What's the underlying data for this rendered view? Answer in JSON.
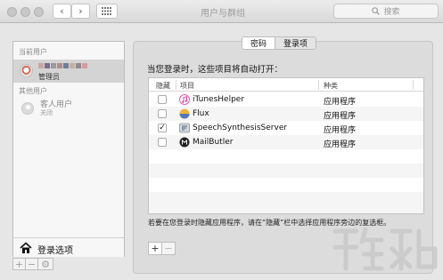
{
  "window": {
    "title": "用户与群组",
    "search_placeholder": "搜索",
    "back_icon": "‹",
    "forward_icon": "›"
  },
  "sidebar": {
    "current_users_label": "当前用户",
    "current_user_role": "管理员",
    "other_users_label": "其他用户",
    "guest_name": "客人用户",
    "guest_status": "关闭",
    "login_options_label": "登录选项",
    "add_label": "+",
    "remove_label": "−",
    "gear_label": "⚙"
  },
  "tabs": [
    {
      "label": "密码",
      "active": false
    },
    {
      "label": "登录项",
      "active": true
    }
  ],
  "heading": "当您登录时，这些项目将自动打开：",
  "table": {
    "columns": [
      "隐藏",
      "项目",
      "种类"
    ],
    "rows": [
      {
        "checked": false,
        "name": "iTunesHelper",
        "kind": "应用程序",
        "icon": "itunes-icon"
      },
      {
        "checked": false,
        "name": "Flux",
        "kind": "应用程序",
        "icon": "flux-icon"
      },
      {
        "checked": true,
        "name": "SpeechSynthesisServer",
        "kind": "应用程序",
        "icon": "speech-icon"
      },
      {
        "checked": false,
        "name": "MailButler",
        "kind": "应用程序",
        "icon": "mailbutler-icon"
      }
    ],
    "check_mark": "✓"
  },
  "note": "若要在您登录时隐藏应用程序，请在“隐藏”栏中选择应用程序旁边的复选框。",
  "add_label": "+",
  "remove_label": "−",
  "colors": {
    "window_bg": "#e6e6e6",
    "selected_row": "#d4d4d4",
    "panel_bg": "#dcdcdc"
  }
}
